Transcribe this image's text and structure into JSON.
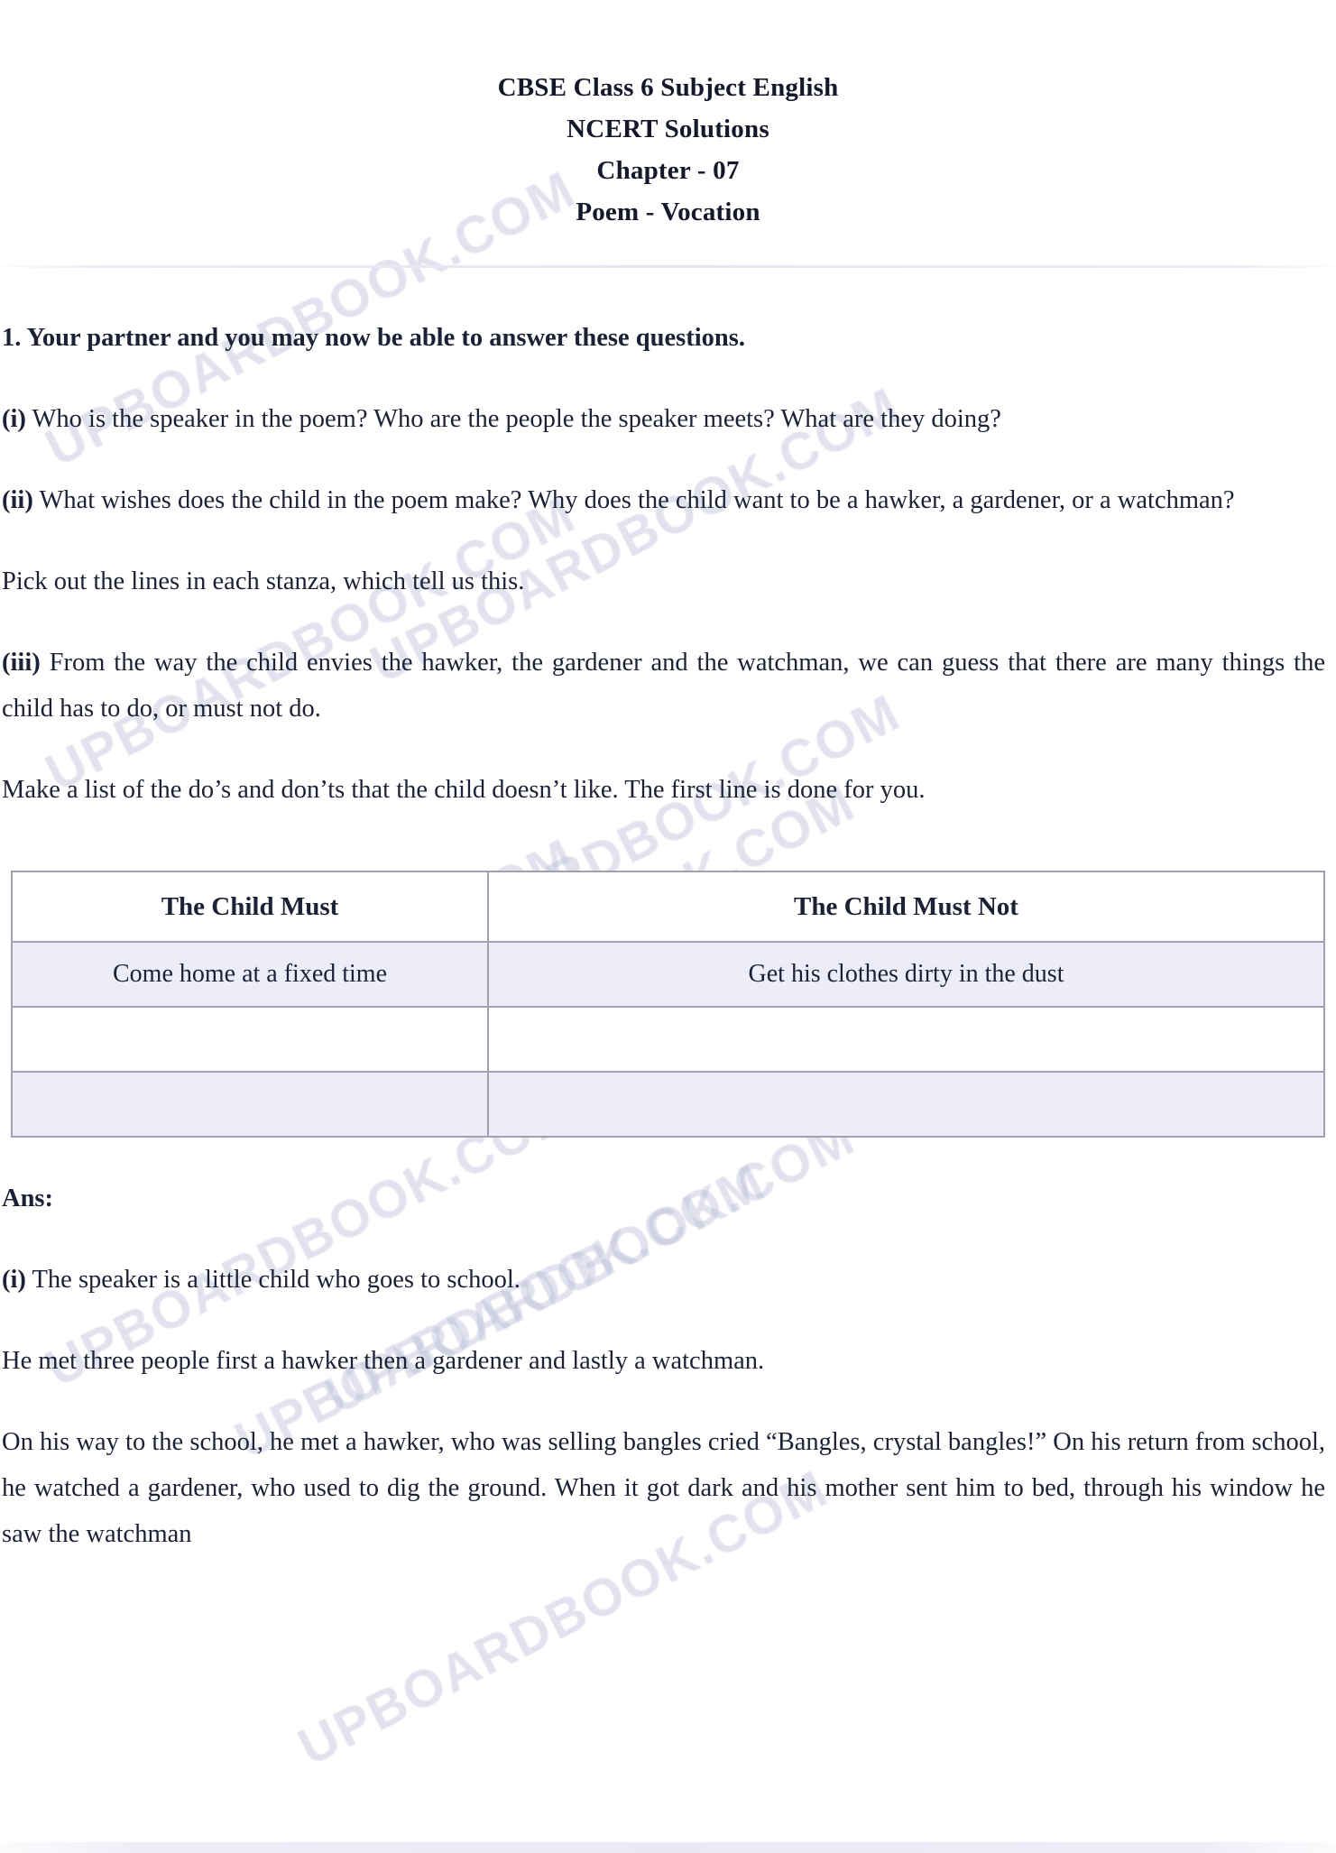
{
  "document": {
    "watermark_text": "UPBOARDBOOK.COM",
    "header": {
      "line1": "CBSE Class 6 Subject English",
      "line2": "NCERT Solutions",
      "line3": "Chapter - 07",
      "line4": "Poem - Vocation"
    },
    "question_heading": "1. Your partner and you may now be able to answer these questions.",
    "questions": [
      {
        "label": "(i)",
        "text": " Who is the speaker in the poem? Who are the people the speaker meets? What are they doing?"
      },
      {
        "label": "(ii)",
        "text": " What wishes does the child in the poem make? Why does the child want to be a hawker, a gardener, or a watchman?"
      }
    ],
    "instruction_1": "Pick out the lines in each stanza, which tell us this.",
    "question_iii": {
      "label": "(iii)",
      "text": " From the way the child envies the hawker, the gardener and the watchman, we can guess that there are many things the child has to do, or must not do."
    },
    "instruction_2": "Make a list of the do’s and don’ts that the child doesn’t like. The first line is done for you.",
    "table": {
      "headers": [
        "The Child Must",
        "The Child Must Not"
      ],
      "rows": [
        [
          "Come home at a fixed time",
          "Get his clothes dirty in the dust"
        ],
        [
          "",
          ""
        ],
        [
          "",
          ""
        ]
      ]
    },
    "answer_label": "Ans:",
    "answers": [
      {
        "label": "(i)",
        "text": " The speaker is a little child who goes to school."
      }
    ],
    "answer_paragraphs": [
      "He met three people first a hawker then a gardener and lastly a watchman.",
      "On his way to the school, he met a hawker, who was selling bangles cried “Bangles, crystal bangles!” On his return from school, he watched a gardener, who used to dig the ground. When it got dark and his mother sent him to bed, through his window he saw the watchman"
    ]
  },
  "colors": {
    "text": "#1d2136",
    "table_border": "#9fa0b0",
    "row_tint": "#ecedf9",
    "watermark": "#b9bcd6",
    "rule": "#e6e4f3"
  }
}
